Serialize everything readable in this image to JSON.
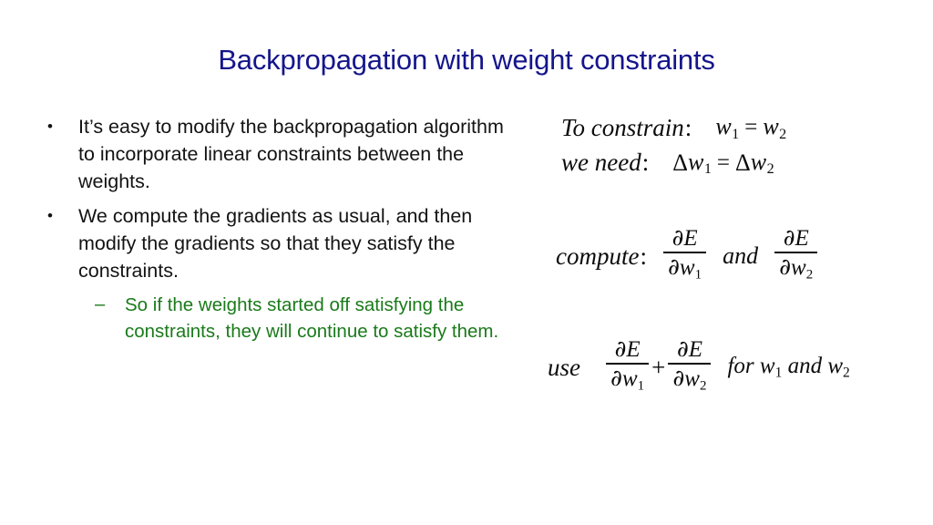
{
  "slide": {
    "title": "Backpropagation with weight constraints",
    "title_color": "#15158c",
    "background_color": "#ffffff",
    "body_color": "#131313",
    "accent_green": "#1a7a1a"
  },
  "bullets": [
    {
      "level": 1,
      "marker": "•",
      "text": "It’s easy to modify the backpropagation algorithm to incorporate linear constraints between the weights.",
      "color": "#131313"
    },
    {
      "level": 1,
      "marker": "•",
      "text": "We compute the gradients as usual, and then modify the gradients so that they satisfy the constraints.",
      "color": "#131313"
    },
    {
      "level": 2,
      "marker": "–",
      "text": "So if the weights started off satisfying the constraints, they will continue to satisfy them.",
      "color": "#1a7a1a"
    }
  ],
  "equations": {
    "constrain": {
      "label": "To  constrain",
      "colon": ":",
      "lhs_var": "w",
      "lhs_sub": "1",
      "operator": "=",
      "rhs_var": "w",
      "rhs_sub": "2",
      "plain": "To constrain: w1 = w2"
    },
    "need": {
      "label": "we  need",
      "colon": ":",
      "delta": "Δ",
      "lhs_var": "w",
      "lhs_sub": "1",
      "operator": "=",
      "rhs_var": "w",
      "rhs_sub": "2",
      "plain": "we need: Δw1 = Δw2"
    },
    "compute": {
      "label": "compute",
      "colon": ":",
      "frac1_num_partial": "∂",
      "frac1_num_var": "E",
      "frac1_den_partial": "∂",
      "frac1_den_var": "w",
      "frac1_den_sub": "1",
      "conjunction": "and",
      "frac2_num_partial": "∂",
      "frac2_num_var": "E",
      "frac2_den_partial": "∂",
      "frac2_den_var": "w",
      "frac2_den_sub": "2",
      "plain": "compute: ∂E/∂w1 and ∂E/∂w2"
    },
    "use": {
      "label": "use",
      "frac1_num_partial": "∂",
      "frac1_num_var": "E",
      "frac1_den_partial": "∂",
      "frac1_den_var": "w",
      "frac1_den_sub": "1",
      "plus": "+",
      "frac2_num_partial": "∂",
      "frac2_num_var": "E",
      "frac2_den_partial": "∂",
      "frac2_den_var": "w",
      "frac2_den_sub": "2",
      "trailing_for": "for",
      "trailing_var1": "w",
      "trailing_sub1": "1",
      "trailing_and": "and",
      "trailing_var2": "w",
      "trailing_sub2": "2",
      "plain": "use ∂E/∂w1 + ∂E/∂w2 for w1 and w2"
    }
  }
}
